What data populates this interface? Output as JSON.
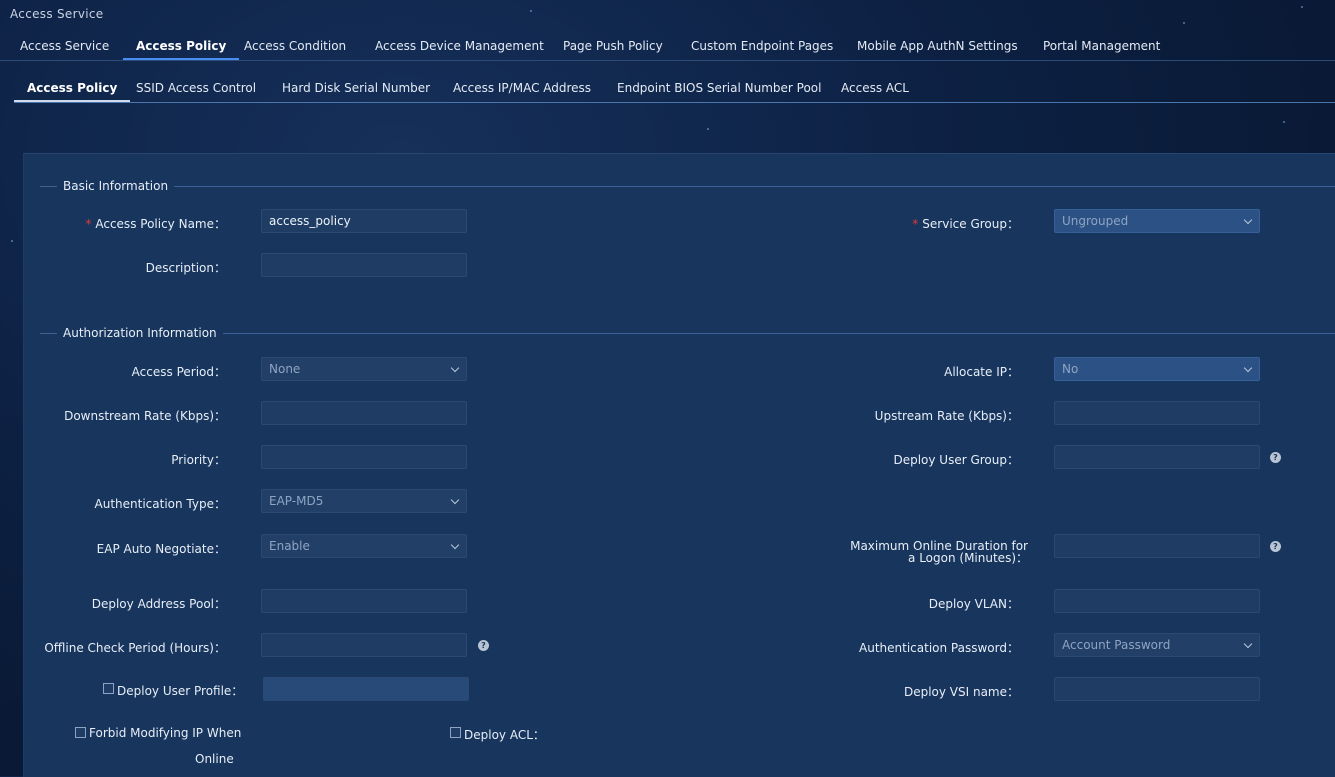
{
  "app_title": "Access Service",
  "main_tabs": [
    {
      "label": "Access Service"
    },
    {
      "label": "Access Policy"
    },
    {
      "label": "Access Condition"
    },
    {
      "label": "Access Device Management"
    },
    {
      "label": "Page Push Policy"
    },
    {
      "label": "Custom Endpoint Pages"
    },
    {
      "label": "Mobile App AuthN Settings"
    },
    {
      "label": "Portal Management"
    }
  ],
  "sub_tabs": [
    {
      "label": "Access Policy"
    },
    {
      "label": "SSID Access Control"
    },
    {
      "label": "Hard Disk Serial Number"
    },
    {
      "label": "Access IP/MAC Address"
    },
    {
      "label": "Endpoint BIOS Serial Number Pool"
    },
    {
      "label": "Access ACL"
    }
  ],
  "basic": {
    "section_title": "Basic Information",
    "required_mark": "*",
    "policy_name_label": "Access Policy Name：",
    "policy_name_value": "access_policy",
    "service_group_label": "Service Group：",
    "service_group_value": "Ungrouped",
    "description_label": "Description：",
    "description_value": ""
  },
  "auth": {
    "section_title": "Authorization Information",
    "help_glyph": "?",
    "access_period_label": "Access Period：",
    "access_period_value": "None",
    "allocate_ip_label": "Allocate IP：",
    "allocate_ip_value": "No",
    "downstream_label": "Downstream Rate (Kbps)：",
    "upstream_label": "Upstream Rate (Kbps)：",
    "priority_label": "Priority：",
    "deploy_user_group_label": "Deploy User Group：",
    "auth_type_label": "Authentication Type：",
    "auth_type_value": "EAP-MD5",
    "eap_label": "EAP Auto Negotiate：",
    "eap_value": "Enable",
    "max_online_label": "Maximum Online Duration for a Logon (Minutes)：",
    "deploy_address_pool_label": "Deploy Address Pool：",
    "deploy_vlan_label": "Deploy VLAN：",
    "offline_check_label": "Offline Check Period (Hours)：",
    "auth_password_label": "Authentication Password：",
    "auth_password_value": "Account Password",
    "deploy_user_profile_label": "Deploy User Profile：",
    "deploy_vsi_label": "Deploy VSI name：",
    "forbid_ip_label_line1": "Forbid Modifying IP When",
    "forbid_ip_label_line2": "Online",
    "deploy_acl_label": "Deploy ACL："
  }
}
